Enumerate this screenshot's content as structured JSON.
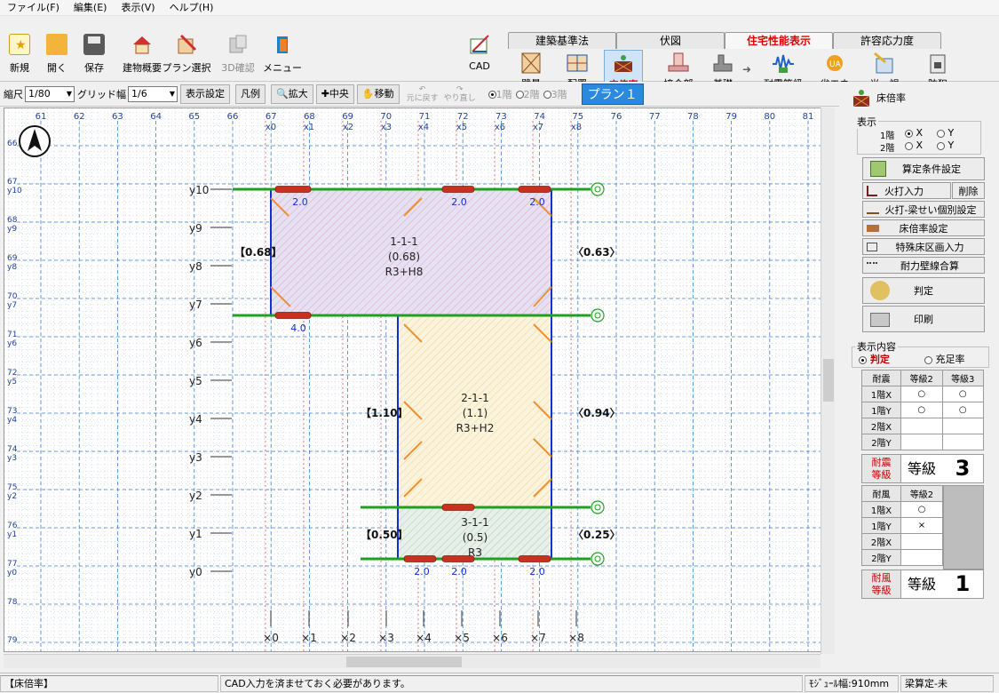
{
  "menu": [
    "ファイル(F)",
    "編集(E)",
    "表示(V)",
    "ヘルプ(H)"
  ],
  "toolbar": [
    {
      "label": "新規",
      "icon": "new-file-icon",
      "color": "#f4c430"
    },
    {
      "label": "開く",
      "icon": "open-folder-icon",
      "color": "#f0a020"
    },
    {
      "label": "保存",
      "icon": "save-icon",
      "color": "#6a6a6a"
    },
    {
      "label": "建物概要",
      "icon": "house-icon",
      "color": "#c03030"
    },
    {
      "label": "プラン選択",
      "icon": "plan-select-icon",
      "color": "#d05040"
    },
    {
      "label": "3D確認",
      "icon": "3d-view-icon",
      "color": "#a0a0a0",
      "disabled": true
    },
    {
      "label": "メニュー",
      "icon": "menu-door-icon",
      "color": "#2080c0"
    },
    {
      "label": "CAD",
      "icon": "cad-icon",
      "color": "#3a7a3a"
    }
  ],
  "tabs": [
    "建築基準法",
    "伏図",
    "住宅性能表示",
    "許容応力度"
  ],
  "active_tab": "住宅性能表示",
  "ribbon": [
    {
      "label": "壁量",
      "icon": "wall-icon"
    },
    {
      "label": "配置",
      "icon": "layout-icon"
    },
    {
      "label": "床倍率",
      "icon": "floor-ratio-icon",
      "active": true
    },
    {
      "label": "接合部",
      "icon": "joint-icon"
    },
    {
      "label": "基礎",
      "icon": "foundation-icon"
    },
    {
      "label": "耐震等級",
      "icon": "seismic-grade-icon"
    },
    {
      "label": "省エネ",
      "icon": "energy-saving-icon"
    },
    {
      "label": "光・視",
      "icon": "light-view-icon"
    },
    {
      "label": "防犯",
      "icon": "security-lock-icon"
    }
  ],
  "options": {
    "scale_label": "縮尺",
    "scale_value": "1/80",
    "grid_label": "グリッド幅",
    "grid_value": "1/6",
    "display_settings": "表示設定",
    "legend": "凡例",
    "zoom": "拡大",
    "center": "中央",
    "move": "移動",
    "undo": "元に戻す",
    "redo": "やり直し",
    "floors": [
      "1階",
      "2階",
      "3階"
    ],
    "plan": "プラン１"
  },
  "canvas": {
    "top_ruler": [
      "61",
      "62",
      "63",
      "64",
      "65",
      "66",
      "67",
      "68",
      "69",
      "70",
      "71",
      "72",
      "73",
      "74",
      "75",
      "76",
      "77",
      "78",
      "79",
      "80",
      "81"
    ],
    "x_labels": [
      "x0",
      "x1",
      "x2",
      "x3",
      "x4",
      "x5",
      "x6",
      "x7",
      "x8"
    ],
    "left_ruler": [
      {
        "num": "66",
        "y": ""
      },
      {
        "num": "67",
        "y": "y10"
      },
      {
        "num": "68",
        "y": "y9"
      },
      {
        "num": "69",
        "y": "y8"
      },
      {
        "num": "70",
        "y": "y7"
      },
      {
        "num": "71",
        "y": "y6"
      },
      {
        "num": "72",
        "y": "y5"
      },
      {
        "num": "73",
        "y": "y4"
      },
      {
        "num": "74",
        "y": "y3"
      },
      {
        "num": "75",
        "y": "y2"
      },
      {
        "num": "76",
        "y": "y1"
      },
      {
        "num": "77",
        "y": "y0"
      },
      {
        "num": "78",
        "y": ""
      },
      {
        "num": "79",
        "y": ""
      }
    ],
    "y_axis": [
      "y10",
      "y9",
      "y8",
      "y7",
      "y6",
      "y5",
      "y4",
      "y3",
      "y2",
      "y1",
      "y0"
    ],
    "zones": [
      {
        "id": "1-1-1",
        "ratio": "(0.68)",
        "spec": "R3+H8",
        "left": "【0.68】",
        "right": "〈0.63〉"
      },
      {
        "id": "2-1-1",
        "ratio": "(1.1)",
        "spec": "R3+H2",
        "left": "【1.10】",
        "right": "〈0.94〉"
      },
      {
        "id": "3-1-1",
        "ratio": "(0.5)",
        "spec": "R3",
        "left": "【0.50】",
        "right": "〈0.25〉"
      }
    ],
    "beam_values": [
      "2.0",
      "2.0",
      "2.0",
      "4.0",
      "2.0",
      "2.0",
      "2.0"
    ]
  },
  "panel": {
    "title": "床倍率",
    "display_group": "表示",
    "floor1": "1階",
    "floor2": "2階",
    "x": "X",
    "y": "Y",
    "buttons": [
      "算定条件設定",
      "火打入力",
      "削除",
      "火打-梁せい個別設定",
      "床倍率設定",
      "特殊床区画入力",
      "耐力壁線合算"
    ],
    "judge": "判定",
    "print": "印刷",
    "content_group": "表示内容",
    "content_opts": [
      "判定",
      "充足率"
    ],
    "seismic": {
      "headers": [
        "耐震",
        "等級2",
        "等級3"
      ],
      "rows": [
        [
          "1階X",
          "○",
          "○"
        ],
        [
          "1階Y",
          "○",
          "○"
        ],
        [
          "2階X",
          "",
          ""
        ],
        [
          "2階Y",
          "",
          ""
        ]
      ],
      "grade_label": "耐震\n等級",
      "grade_word": "等級",
      "grade_num": "3"
    },
    "wind": {
      "headers": [
        "耐風",
        "等級2"
      ],
      "rows": [
        [
          "1階X",
          "○"
        ],
        [
          "1階Y",
          "×"
        ],
        [
          "2階X",
          ""
        ],
        [
          "2階Y",
          ""
        ]
      ],
      "grade_label": "耐風\n等級",
      "grade_word": "等級",
      "grade_num": "1"
    }
  },
  "status": {
    "mode": "【床倍率】",
    "message": "CAD入力を済ませておく必要があります。",
    "module": "ﾓｼﾞｭｰﾙ幅:910mm",
    "beam": "梁算定-未"
  }
}
